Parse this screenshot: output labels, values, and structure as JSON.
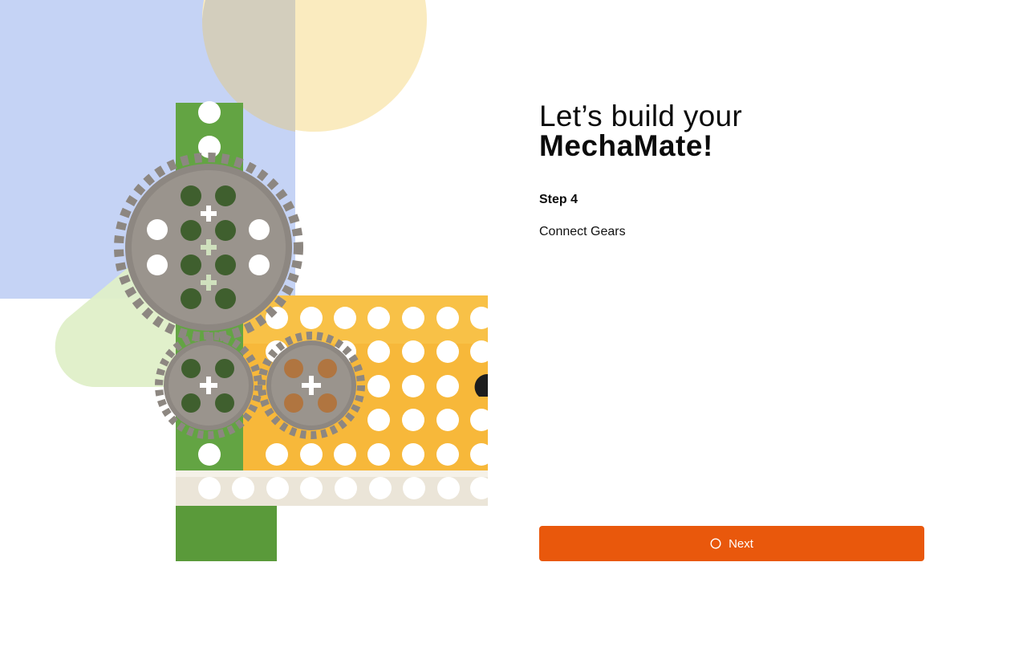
{
  "headline": {
    "line1": "Let’s build your",
    "line2": "MechaMate!"
  },
  "step": {
    "title": "Step 4",
    "description": "Connect Gears"
  },
  "next_button": {
    "label": "Next",
    "icon": "circle-loading-icon"
  },
  "colors": {
    "accent": "#e9580c",
    "bg_blue": "#c5d3f5",
    "bg_yellow": "#faebbf",
    "bg_green": "#dfefc8",
    "brick_green": "#5e9c3e",
    "brick_yellow": "#f7b83a",
    "brick_white": "#ebe5d8",
    "gear_gray": "#8d8781"
  }
}
